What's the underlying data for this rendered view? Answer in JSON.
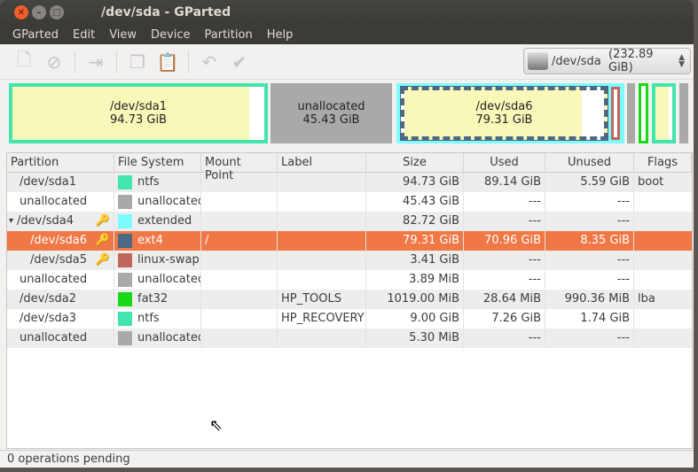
{
  "window": {
    "title": "/dev/sda - GParted"
  },
  "menu": [
    "GParted",
    "Edit",
    "View",
    "Device",
    "Partition",
    "Help"
  ],
  "toolbar": {
    "icons": [
      "new-icon",
      "delete-icon",
      "resize-move-icon",
      "copy-icon",
      "paste-icon",
      "undo-icon",
      "apply-icon"
    ]
  },
  "device": {
    "name": "/dev/sda",
    "size": "(232.89 GiB)"
  },
  "graph": [
    {
      "name": "/dev/sda1",
      "size": "94.73 GiB",
      "used_fraction": 0.94,
      "color": "#42e5ac"
    },
    {
      "name": "unallocated",
      "size": "45.43 GiB",
      "color": "#a9a9a9"
    },
    {
      "name": "/dev/sda6",
      "size": "79.31 GiB",
      "used_fraction": 0.89,
      "color": "#4b6983"
    }
  ],
  "table": {
    "columns": [
      "Partition",
      "File System",
      "Mount Point",
      "Label",
      "Size",
      "Used",
      "Unused",
      "Flags"
    ],
    "rows": [
      {
        "partition": "/dev/sda1",
        "fs": "ntfs",
        "color": "#42e5ac",
        "mount": "",
        "label": "",
        "size": "94.73 GiB",
        "used": "89.14 GiB",
        "unused": "5.59 GiB",
        "flags": "boot",
        "indent": 0,
        "key": false
      },
      {
        "partition": "unallocated",
        "fs": "unallocated",
        "color": "#a9a9a9",
        "mount": "",
        "label": "",
        "size": "45.43 GiB",
        "used": "---",
        "unused": "---",
        "flags": "",
        "indent": 0,
        "key": false
      },
      {
        "partition": "/dev/sda4",
        "fs": "extended",
        "color": "#7dfcfe",
        "mount": "",
        "label": "",
        "size": "82.72 GiB",
        "used": "---",
        "unused": "---",
        "flags": "",
        "indent": 0,
        "key": true,
        "expander": "▾"
      },
      {
        "partition": "/dev/sda6",
        "fs": "ext4",
        "color": "#4b6983",
        "mount": "/",
        "label": "",
        "size": "79.31 GiB",
        "used": "70.96 GiB",
        "unused": "8.35 GiB",
        "flags": "",
        "indent": 1,
        "key": true,
        "selected": true
      },
      {
        "partition": "/dev/sda5",
        "fs": "linux-swap",
        "color": "#c1665a",
        "mount": "",
        "label": "",
        "size": "3.41 GiB",
        "used": "---",
        "unused": "---",
        "flags": "",
        "indent": 1,
        "key": true
      },
      {
        "partition": "unallocated",
        "fs": "unallocated",
        "color": "#a9a9a9",
        "mount": "",
        "label": "",
        "size": "3.89 MiB",
        "used": "---",
        "unused": "---",
        "flags": "",
        "indent": 0,
        "key": false
      },
      {
        "partition": "/dev/sda2",
        "fs": "fat32",
        "color": "#18d918",
        "mount": "",
        "label": "HP_TOOLS",
        "size": "1019.00 MiB",
        "used": "28.64 MiB",
        "unused": "990.36 MiB",
        "flags": "lba",
        "indent": 0,
        "key": false
      },
      {
        "partition": "/dev/sda3",
        "fs": "ntfs",
        "color": "#42e5ac",
        "mount": "",
        "label": "HP_RECOVERY",
        "size": "9.00 GiB",
        "used": "7.26 GiB",
        "unused": "1.74 GiB",
        "flags": "",
        "indent": 0,
        "key": false
      },
      {
        "partition": "unallocated",
        "fs": "unallocated",
        "color": "#a9a9a9",
        "mount": "",
        "label": "",
        "size": "5.30 MiB",
        "used": "---",
        "unused": "---",
        "flags": "",
        "indent": 0,
        "key": false
      }
    ]
  },
  "status": "0 operations pending"
}
